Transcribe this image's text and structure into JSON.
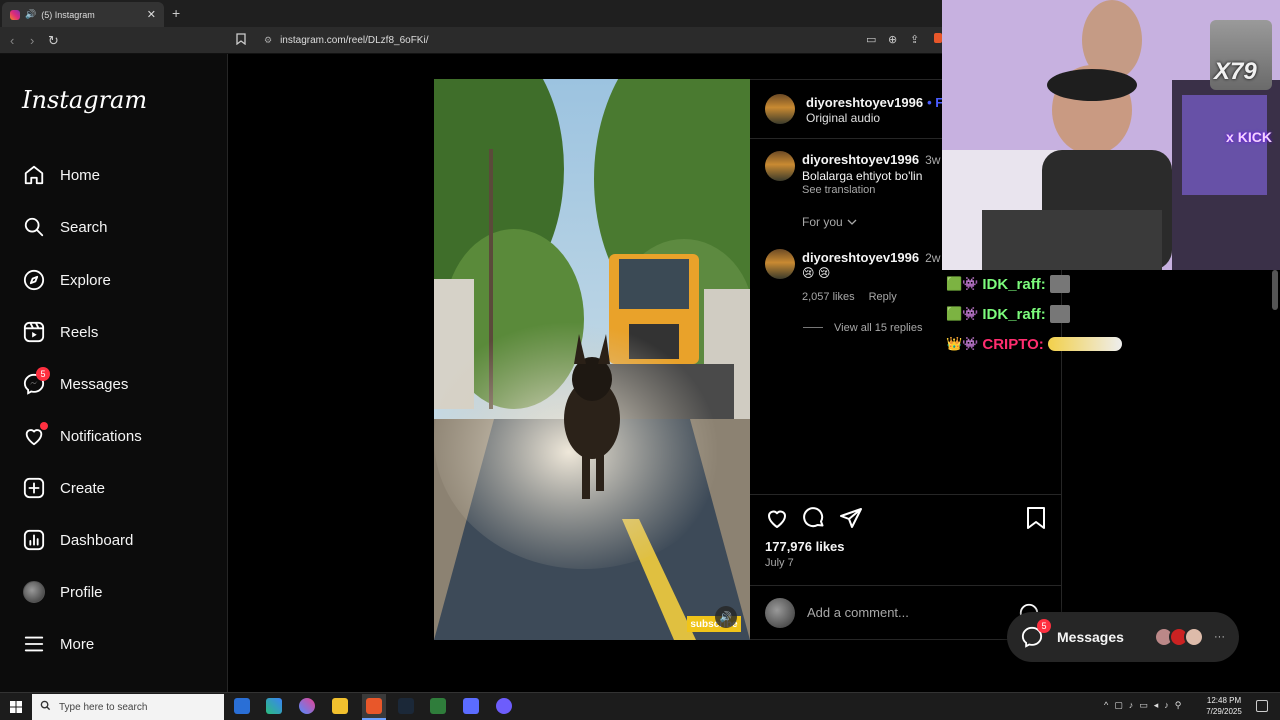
{
  "browser": {
    "tab_title": "(5) Instagram",
    "new_tab": "+",
    "url": "instagram.com/reel/DLzf8_6oFKi/"
  },
  "sidebar": {
    "logo": "Instagram",
    "items": [
      {
        "label": "Home",
        "icon": "home-icon"
      },
      {
        "label": "Search",
        "icon": "search-icon"
      },
      {
        "label": "Explore",
        "icon": "compass-icon"
      },
      {
        "label": "Reels",
        "icon": "reels-icon"
      },
      {
        "label": "Messages",
        "icon": "messenger-icon",
        "badge": "5"
      },
      {
        "label": "Notifications",
        "icon": "heart-icon"
      },
      {
        "label": "Create",
        "icon": "plus-square-icon"
      },
      {
        "label": "Dashboard",
        "icon": "dashboard-icon"
      },
      {
        "label": "Profile",
        "icon": "avatar"
      },
      {
        "label": "More",
        "icon": "hamburger-icon"
      }
    ]
  },
  "reel": {
    "sticker": "subscribe"
  },
  "post": {
    "author": "diyoreshtoyev1996",
    "follow": "• Fo",
    "audio": "Original audio",
    "caption_user": "diyoreshtoyev1996",
    "caption_age": "3w",
    "caption_text": "Bolalarga ehtiyot bo'lin",
    "see_translation": "See translation",
    "for_you": "For you",
    "comment": {
      "user": "diyoreshtoyev1996",
      "age": "2w",
      "text": "😢 😢",
      "likes": "2,057 likes",
      "reply": "Reply",
      "view_replies": "View all 15 replies"
    },
    "likes": "177,976 likes",
    "date": "July 7",
    "add_comment_placeholder": "Add a comment..."
  },
  "chat": [
    {
      "user": "IDK_raff:",
      "color": "#7CFC7C"
    },
    {
      "user": "IDK_raff:",
      "color": "#7CFC7C"
    },
    {
      "user": "CRIPTO:",
      "color": "#ff2d6f"
    }
  ],
  "overlay": {
    "counter": "X79",
    "side_text": "x KICK"
  },
  "messages_pill": {
    "label": "Messages",
    "badge": "5",
    "more": "···"
  },
  "taskbar": {
    "search_placeholder": "Type here to search",
    "time": "12:48 PM",
    "date": "7/29/2025"
  }
}
